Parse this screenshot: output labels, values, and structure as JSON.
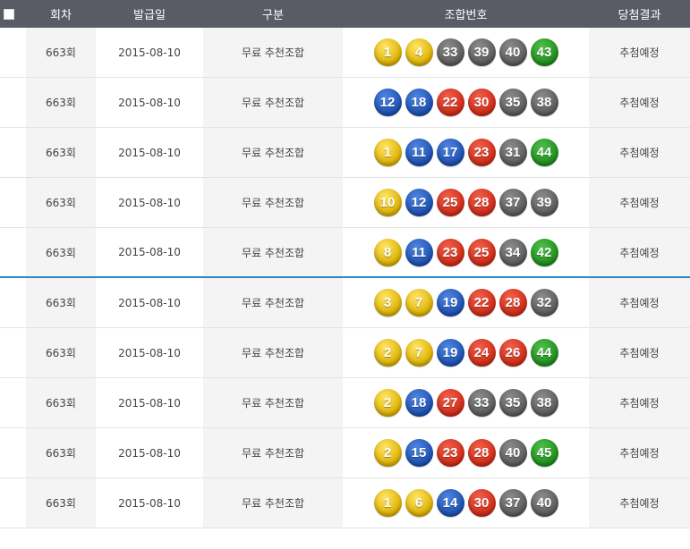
{
  "header": {
    "round": "회차",
    "date": "발급일",
    "type": "구분",
    "numbers": "조합번호",
    "result": "당첨결과"
  },
  "colors": {
    "header_bg": "#595c65",
    "divider": "#2a86c2",
    "ball_1_10": "#dcb000",
    "ball_11_20": "#1c4fb0",
    "ball_21_30": "#cf2a16",
    "ball_31_40": "#5a5a5a",
    "ball_41_45": "#1f8d1c"
  },
  "rows": [
    {
      "round": "663회",
      "date": "2015-08-10",
      "type": "무료 추천조합",
      "numbers": [
        "1",
        "4",
        "33",
        "39",
        "40",
        "43"
      ],
      "colors": [
        "y",
        "y",
        "g",
        "g",
        "g",
        "gr"
      ],
      "result": "추첨예정"
    },
    {
      "round": "663회",
      "date": "2015-08-10",
      "type": "무료 추천조합",
      "numbers": [
        "12",
        "18",
        "22",
        "30",
        "35",
        "38"
      ],
      "colors": [
        "b",
        "b",
        "r",
        "r",
        "g",
        "g"
      ],
      "result": "추첨예정"
    },
    {
      "round": "663회",
      "date": "2015-08-10",
      "type": "무료 추천조합",
      "numbers": [
        "1",
        "11",
        "17",
        "23",
        "31",
        "44"
      ],
      "colors": [
        "y",
        "b",
        "b",
        "r",
        "g",
        "gr"
      ],
      "result": "추첨예정"
    },
    {
      "round": "663회",
      "date": "2015-08-10",
      "type": "무료 추천조합",
      "numbers": [
        "10",
        "12",
        "25",
        "28",
        "37",
        "39"
      ],
      "colors": [
        "y",
        "b",
        "r",
        "r",
        "g",
        "g"
      ],
      "result": "추첨예정"
    },
    {
      "round": "663회",
      "date": "2015-08-10",
      "type": "무료 추천조합",
      "numbers": [
        "8",
        "11",
        "23",
        "25",
        "34",
        "42"
      ],
      "colors": [
        "y",
        "b",
        "r",
        "r",
        "g",
        "gr"
      ],
      "result": "추첨예정"
    },
    {
      "round": "663회",
      "date": "2015-08-10",
      "type": "무료 추천조합",
      "numbers": [
        "3",
        "7",
        "19",
        "22",
        "28",
        "32"
      ],
      "colors": [
        "y",
        "y",
        "b",
        "r",
        "r",
        "g"
      ],
      "result": "추첨예정"
    },
    {
      "round": "663회",
      "date": "2015-08-10",
      "type": "무료 추천조합",
      "numbers": [
        "2",
        "7",
        "19",
        "24",
        "26",
        "44"
      ],
      "colors": [
        "y",
        "y",
        "b",
        "r",
        "r",
        "gr"
      ],
      "result": "추첨예정"
    },
    {
      "round": "663회",
      "date": "2015-08-10",
      "type": "무료 추천조합",
      "numbers": [
        "2",
        "18",
        "27",
        "33",
        "35",
        "38"
      ],
      "colors": [
        "y",
        "b",
        "r",
        "g",
        "g",
        "g"
      ],
      "result": "추첨예정"
    },
    {
      "round": "663회",
      "date": "2015-08-10",
      "type": "무료 추천조합",
      "numbers": [
        "2",
        "15",
        "23",
        "28",
        "40",
        "45"
      ],
      "colors": [
        "y",
        "b",
        "r",
        "r",
        "g",
        "gr"
      ],
      "result": "추첨예정"
    },
    {
      "round": "663회",
      "date": "2015-08-10",
      "type": "무료 추천조합",
      "numbers": [
        "1",
        "6",
        "14",
        "30",
        "37",
        "40"
      ],
      "colors": [
        "y",
        "y",
        "b",
        "r",
        "g",
        "g"
      ],
      "result": "추첨예정"
    }
  ]
}
